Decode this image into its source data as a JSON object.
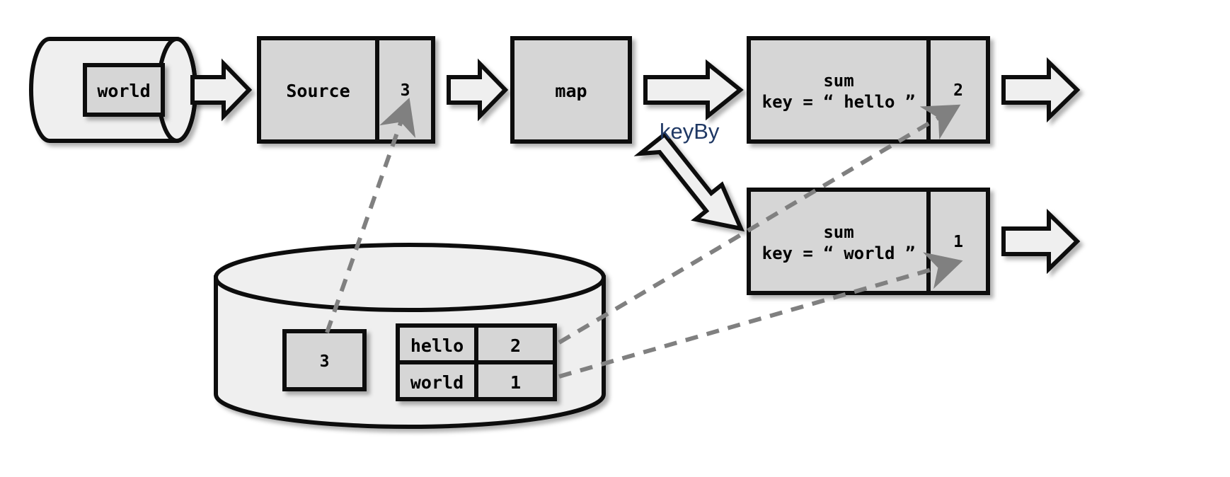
{
  "diagram": {
    "title": "Flink keyBy state diagram",
    "colors": {
      "box_fill": "#d6d6d6",
      "cylinder_fill": "#efefef",
      "arrow_fill": "#efefef",
      "stroke": "#000000",
      "dashed": "#808080",
      "keyby_text": "#1f3864"
    }
  },
  "source_cylinder": {
    "name": "input-stream-cylinder",
    "record_label": "world"
  },
  "source_operator": {
    "label": "Source",
    "state_value": "3"
  },
  "map_operator": {
    "label": "map"
  },
  "keyby": {
    "label": "keyBy"
  },
  "sum_operators": [
    {
      "line1": "sum",
      "line2": "key = “ hello ”",
      "state_value": "2"
    },
    {
      "line1": "sum",
      "line2": "key = “ world ”",
      "state_value": "1"
    }
  ],
  "state_backend": {
    "name": "state-backend-cylinder",
    "operator_state_value": "3",
    "keyed_state_table": {
      "rows": [
        {
          "key": "hello",
          "value": "2"
        },
        {
          "key": "world",
          "value": "1"
        }
      ]
    }
  },
  "arrows": {
    "source_in": "block-arrow-right",
    "source_to_map": "block-arrow-right",
    "map_to_keyby": "block-arrow-right",
    "keyby_diagonal": "block-arrow-diagonal-down-right",
    "sum_hello_out": "block-arrow-right",
    "sum_world_out": "block-arrow-right",
    "state_links": [
      "dashed-arrow-to-source-state",
      "dashed-arrow-to-sum-hello-state",
      "dashed-arrow-to-sum-world-state"
    ]
  }
}
